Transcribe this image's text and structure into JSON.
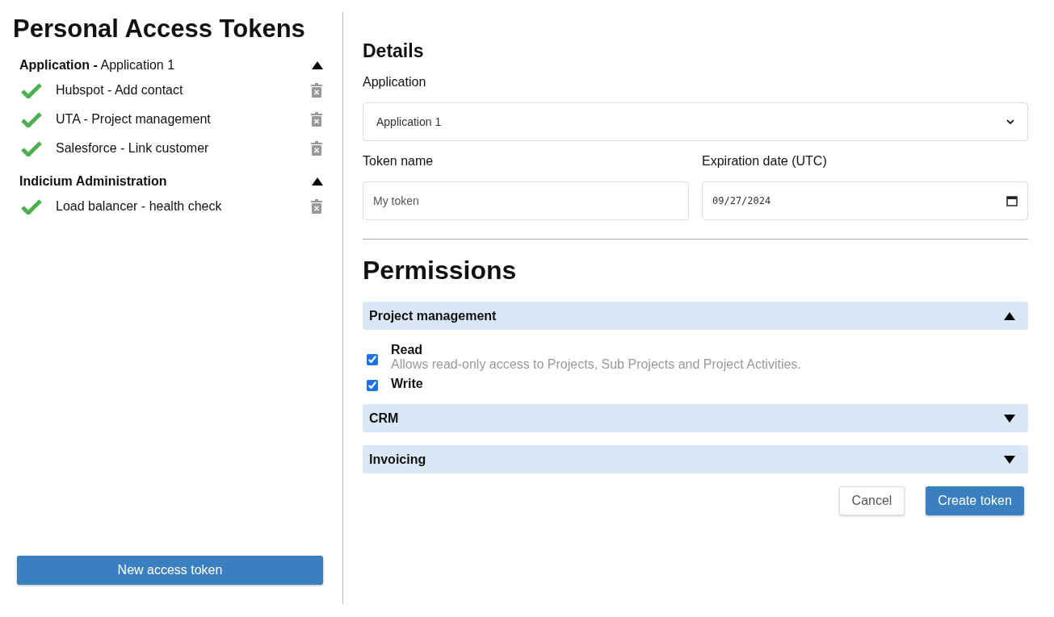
{
  "sidebar": {
    "title": "Personal Access Tokens",
    "groups": [
      {
        "label": "**Application -** Application 1",
        "expanded": true,
        "tokens": [
          {
            "name": "Hubspot - Add contact",
            "active": true
          },
          {
            "name": "UTA - Project management",
            "active": true
          },
          {
            "name": "Salesforce - Link customer",
            "active": true
          }
        ]
      },
      {
        "label": "**Indicium Administration**",
        "expanded": true,
        "tokens": [
          {
            "name": "Load balancer - health check",
            "active": true
          }
        ]
      }
    ],
    "new_button": "New access token"
  },
  "details": {
    "title": "Details",
    "application": {
      "label": "Application",
      "value": "Application 1"
    },
    "token_name": {
      "label": "Token name",
      "placeholder": "My token"
    },
    "expiration": {
      "label": "Expiration date (UTC)",
      "value": "09/27/2024"
    }
  },
  "permissions": {
    "title": "Permissions",
    "sections": [
      {
        "label": "Project management",
        "expanded": true,
        "items": [
          {
            "label": "Read",
            "description": "Allows read-only access to Projects, Sub Projects and Project Activities.",
            "checked": true
          },
          {
            "label": "Write",
            "checked": true
          }
        ]
      },
      {
        "label": "CRM",
        "expanded": false
      },
      {
        "label": "Invoicing",
        "expanded": false
      }
    ]
  },
  "buttons": {
    "cancel": "Cancel",
    "create": "Create token"
  }
}
